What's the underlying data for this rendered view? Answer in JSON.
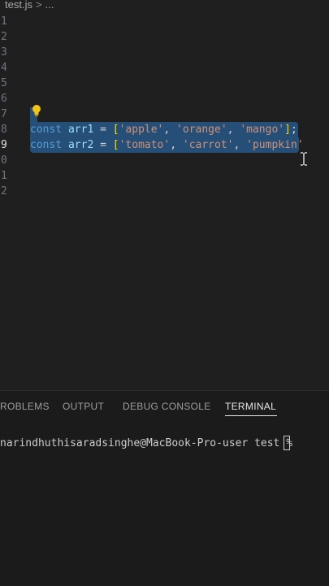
{
  "breadcrumb": {
    "file": "test.js",
    "sep": ">",
    "rest": "..."
  },
  "editor": {
    "line_numbers": [
      "1",
      "2",
      "3",
      "4",
      "5",
      "6",
      "7",
      "8",
      "9",
      "0",
      "1",
      "2"
    ],
    "lines": {
      "line8": {
        "kw": "const",
        "name": "arr1",
        "eq": "=",
        "open": "[",
        "s1": "'apple'",
        "c1": ",",
        "s2": "'orange'",
        "c2": ",",
        "s3": "'mango'",
        "close": "]",
        "semi": ";"
      },
      "line9": {
        "kw": "const",
        "name": "arr2",
        "eq": "=",
        "open": "[",
        "s1": "'tomato'",
        "c1": ",",
        "s2": "'carrot'",
        "c2": ",",
        "s3": "'pumpkin'"
      }
    }
  },
  "panel": {
    "tabs": [
      "ROBLEMS",
      "OUTPUT",
      "DEBUG CONSOLE",
      "TERMINAL"
    ],
    "active_tab": "TERMINAL",
    "terminal_prompt": "narindhuthisaradsinghe@MacBook-Pro-user test % "
  },
  "colors": {
    "selection": "#264f78",
    "keyword": "#569cd6",
    "variable": "#9cdcfe",
    "string": "#ce9178",
    "bracket": "#ffd700"
  }
}
